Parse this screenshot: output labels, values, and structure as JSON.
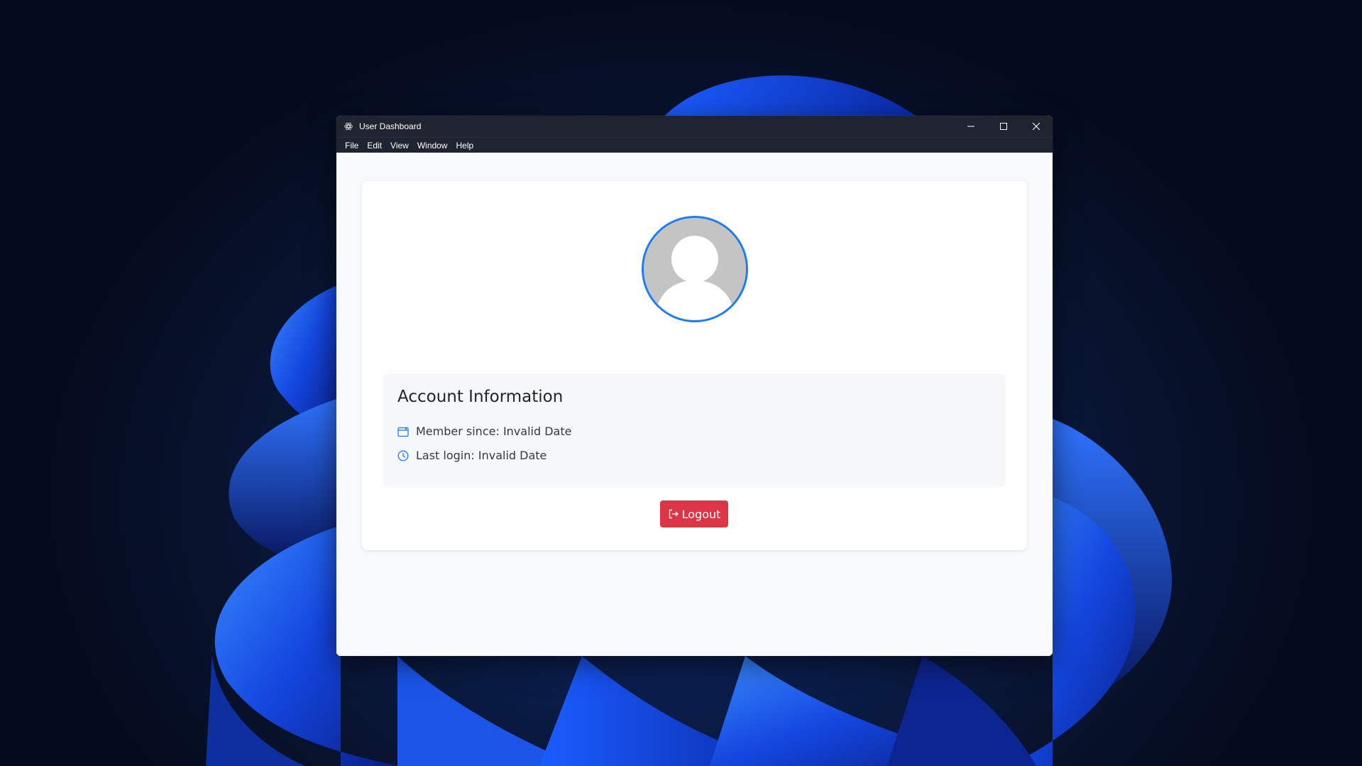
{
  "window": {
    "title": "User Dashboard",
    "controls": {
      "minimize_icon": "minimize-icon",
      "maximize_icon": "maximize-icon",
      "close_icon": "close-icon"
    }
  },
  "menubar": {
    "items": [
      "File",
      "Edit",
      "View",
      "Window",
      "Help"
    ]
  },
  "profile": {
    "avatar_icon": "user-avatar-placeholder",
    "avatar_border_color": "#1e7cf0"
  },
  "account": {
    "title": "Account Information",
    "member_since": "Member since: Invalid Date",
    "last_login": "Last login: Invalid Date",
    "member_since_icon": "calendar-icon",
    "last_login_icon": "clock-icon",
    "icon_color": "#1e7cf0"
  },
  "actions": {
    "logout_label": "Logout",
    "logout_icon": "logout-icon",
    "logout_color": "#dc3545"
  }
}
